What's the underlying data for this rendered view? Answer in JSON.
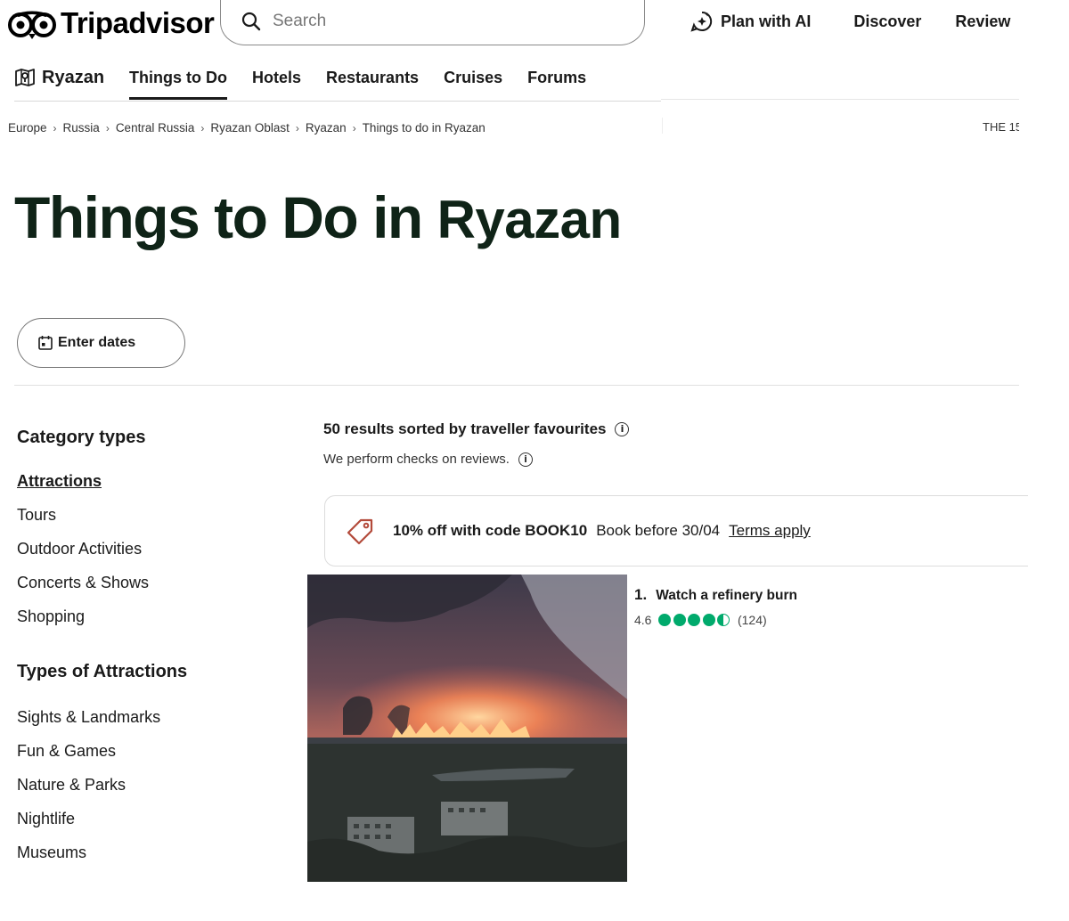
{
  "brand": {
    "name": "Tripadvisor",
    "logo_icon": "owl-eyes-icon"
  },
  "search": {
    "placeholder": "Search"
  },
  "top_nav": {
    "plan_label": "Plan with AI",
    "discover_label": "Discover",
    "review_label": "Review"
  },
  "sub_nav": {
    "city": "Ryazan",
    "links": [
      "Things to Do",
      "Hotels",
      "Restaurants",
      "Cruises",
      "Forums"
    ],
    "active": "Things to Do"
  },
  "breadcrumb": [
    "Europe",
    "Russia",
    "Central Russia",
    "Ryazan Oblast",
    "Ryazan",
    "Things to do in Ryazan"
  ],
  "top_right_cut": "THE 15",
  "page": {
    "title_prefix": "Things to Do in ",
    "title_city": "Ryazan",
    "dates_button": "Enter dates"
  },
  "sidebar": {
    "category_heading": "Category types",
    "categories": [
      "Attractions",
      "Tours",
      "Outdoor Activities",
      "Concerts & Shows",
      "Shopping"
    ],
    "types_heading": "Types of Attractions",
    "types": [
      "Sights & Landmarks",
      "Fun & Games",
      "Nature & Parks",
      "Nightlife",
      "Museums"
    ]
  },
  "results": {
    "summary": "50 results sorted by traveller favourites",
    "checks": "We perform checks on reviews."
  },
  "promo": {
    "code_text": "10% off with code BOOK10",
    "before_text": "Book before 30/04",
    "terms_text": "Terms apply"
  },
  "listing": {
    "rank": "1.",
    "title": "Watch a refinery burn",
    "rating": "4.6",
    "bubbles_filled": 4.5,
    "reviews": "(124)"
  },
  "colors": {
    "brand_green": "#00aa6c",
    "title_dark": "#0f2317"
  }
}
